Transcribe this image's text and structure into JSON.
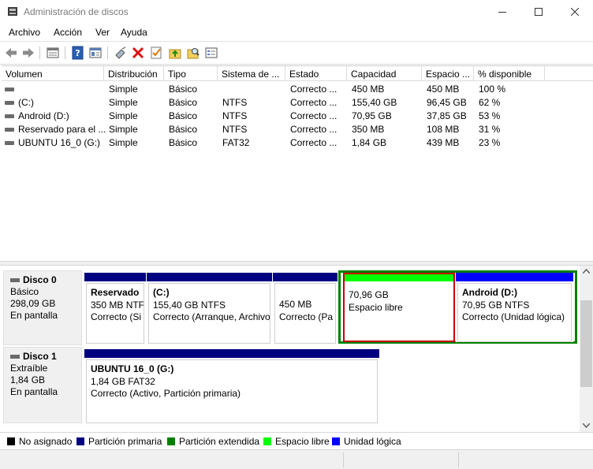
{
  "window": {
    "title": "Administración de discos"
  },
  "menu": [
    "Archivo",
    "Acción",
    "Ver",
    "Ayuda"
  ],
  "toolbar": [
    "back-icon",
    "forward-icon",
    "list-view-icon",
    "help-icon",
    "properties-icon",
    "connect-icon",
    "delete-icon",
    "check-icon",
    "folder-up-icon",
    "search-folder-icon",
    "settings-icon"
  ],
  "columns": [
    "Volumen",
    "Distribución",
    "Tipo",
    "Sistema de ...",
    "Estado",
    "Capacidad",
    "Espacio ...",
    "% disponible"
  ],
  "volumes": [
    {
      "name": "",
      "layout": "Simple",
      "type": "Básico",
      "fs": "",
      "status": "Correcto ...",
      "capacity": "450 MB",
      "free": "450 MB",
      "pct": "100 %"
    },
    {
      "name": "(C:)",
      "layout": "Simple",
      "type": "Básico",
      "fs": "NTFS",
      "status": "Correcto ...",
      "capacity": "155,40 GB",
      "free": "96,45 GB",
      "pct": "62 %"
    },
    {
      "name": "Android (D:)",
      "layout": "Simple",
      "type": "Básico",
      "fs": "NTFS",
      "status": "Correcto ...",
      "capacity": "70,95 GB",
      "free": "37,85 GB",
      "pct": "53 %"
    },
    {
      "name": "Reservado para el ...",
      "layout": "Simple",
      "type": "Básico",
      "fs": "NTFS",
      "status": "Correcto ...",
      "capacity": "350 MB",
      "free": "108 MB",
      "pct": "31 %"
    },
    {
      "name": "UBUNTU 16_0 (G:)",
      "layout": "Simple",
      "type": "Básico",
      "fs": "FAT32",
      "status": "Correcto ...",
      "capacity": "1,84 GB",
      "free": "439 MB",
      "pct": "23 %"
    }
  ],
  "disks": [
    {
      "name": "Disco 0",
      "kind": "Básico",
      "size": "298,09 GB",
      "state": "En pantalla",
      "partitions": [
        {
          "title": "Reservado ",
          "line1": "350 MB NTF",
          "line2": "Correcto (Si"
        },
        {
          "title": "(C:)",
          "line1": "155,40 GB NTFS",
          "line2": "Correcto (Arranque, Archivo"
        },
        {
          "title": "",
          "line1": "450 MB",
          "line2": "Correcto (Pa"
        },
        {
          "title": "",
          "line1": "70,96 GB",
          "line2": "Espacio libre"
        },
        {
          "title": "Android  (D:)",
          "line1": "70,95 GB NTFS",
          "line2": "Correcto (Unidad lógica)"
        }
      ]
    },
    {
      "name": "Disco 1",
      "kind": "Extraíble",
      "size": "1,84 GB",
      "state": "En pantalla",
      "partitions": [
        {
          "title": "UBUNTU 16_0  (G:)",
          "line1": "1,84 GB FAT32",
          "line2": "Correcto (Activo, Partición primaria)"
        }
      ]
    }
  ],
  "legend": [
    {
      "label": "No asignado",
      "color": "#000000"
    },
    {
      "label": "Partición primaria",
      "color": "#000080"
    },
    {
      "label": "Partición extendida",
      "color": "#008000"
    },
    {
      "label": "Espacio libre",
      "color": "#00ff00"
    },
    {
      "label": "Unidad lógica",
      "color": "#0000ff"
    }
  ]
}
